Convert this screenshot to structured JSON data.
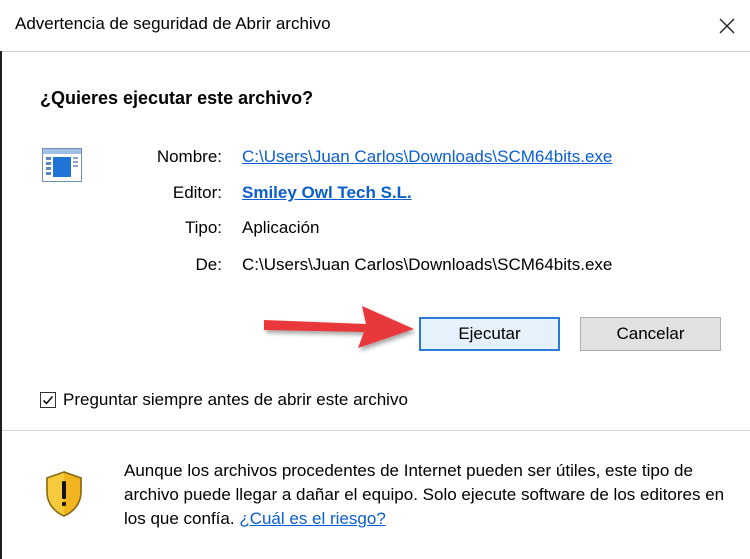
{
  "window": {
    "title": "Advertencia de seguridad de Abrir archivo"
  },
  "dialog": {
    "question": "¿Quieres ejecutar este archivo?",
    "fields": [
      {
        "label": "Nombre:",
        "value": "C:\\Users\\Juan Carlos\\Downloads\\SCM64bits.exe"
      },
      {
        "label": "Editor:",
        "value": "Smiley Owl Tech S.L."
      },
      {
        "label": "Tipo:",
        "value": "Aplicación"
      },
      {
        "label": "De:",
        "value": "C:\\Users\\Juan Carlos\\Downloads\\SCM64bits.exe"
      }
    ],
    "buttons": {
      "run": "Ejecutar",
      "cancel": "Cancelar"
    },
    "checkbox": {
      "label": "Preguntar siempre antes de abrir este archivo",
      "checked": true
    },
    "warning": {
      "text": "Aunque los archivos procedentes de Internet pueden ser útiles, este tipo de archivo puede llegar a dañar el equipo. Solo ejecute software de los editores en los que confía.",
      "link": "¿Cuál es el riesgo?"
    }
  },
  "colors": {
    "link": "#0a5fcf",
    "primary_border": "#2a7ad8",
    "arrow": "#e8393a",
    "shield_yellow": "#f2b51f"
  },
  "icons": {
    "close": "close-icon",
    "app": "application-icon",
    "shield": "warning-shield-icon",
    "arrow": "red-arrow-annotation"
  }
}
